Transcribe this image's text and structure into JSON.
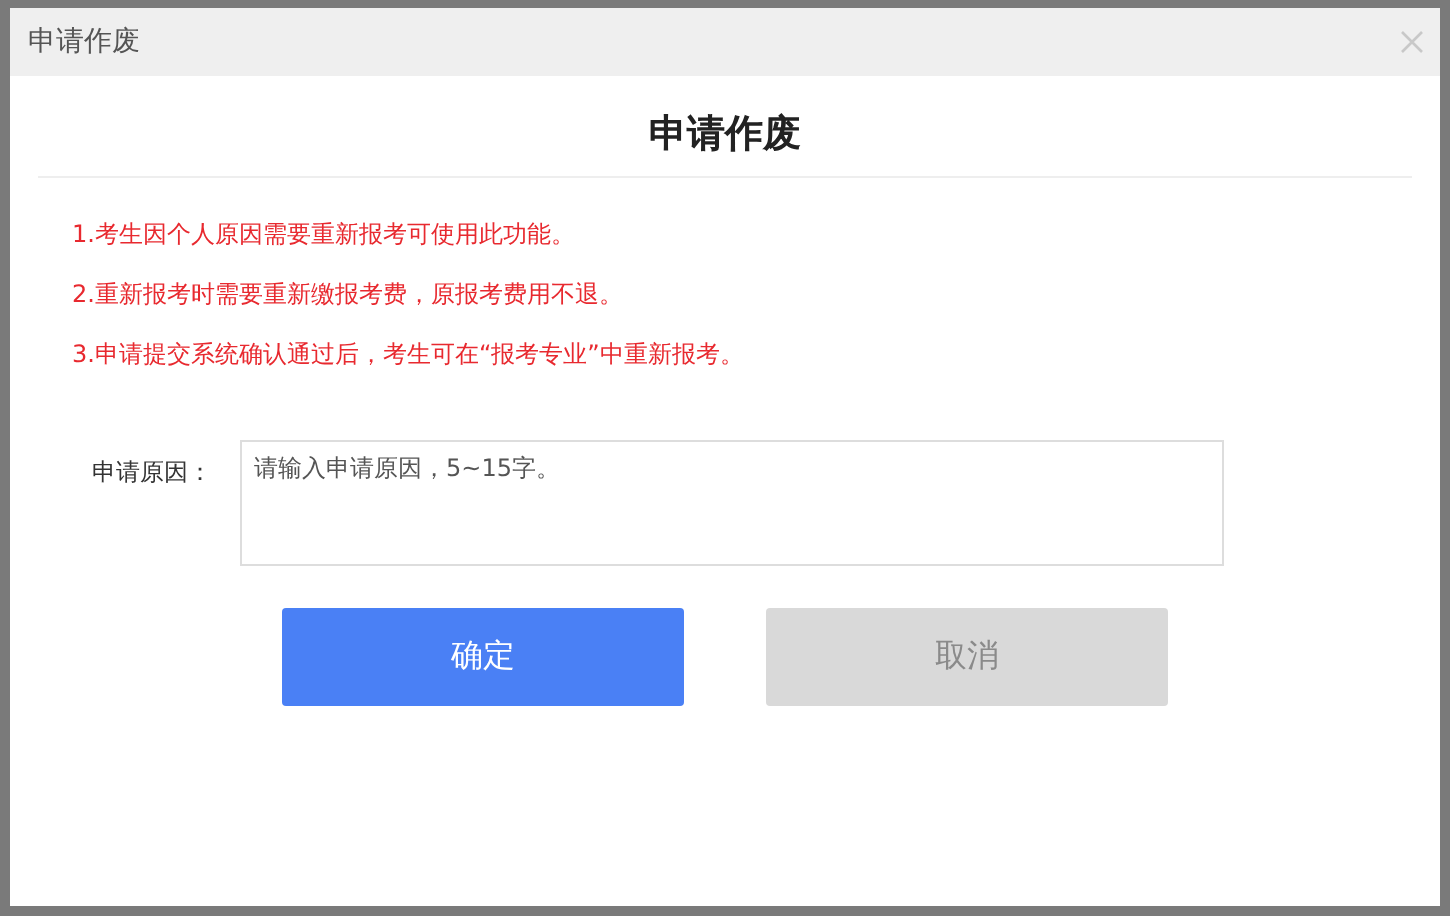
{
  "window": {
    "title": "申请作废"
  },
  "heading": "申请作废",
  "notices": [
    "1.考生因个人原因需要重新报考可使用此功能。",
    "2.重新报考时需要重新缴报考费，原报考费用不退。",
    "3.申请提交系统确认通过后，考生可在“报考专业”中重新报考。"
  ],
  "reason": {
    "label": "申请原因：",
    "placeholder": "请输入申请原因，5~15字。"
  },
  "buttons": [
    {
      "label": "确定",
      "kind": "primary"
    },
    {
      "label": "取消",
      "kind": "secondary"
    }
  ]
}
